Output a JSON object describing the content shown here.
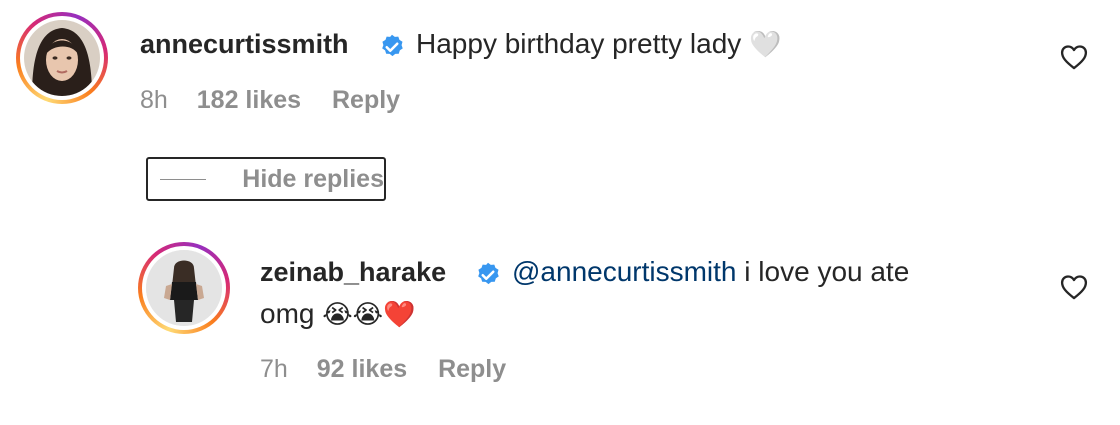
{
  "comment": {
    "username": "annecurtissmith",
    "text": "Happy birthday pretty lady",
    "emoji": "🤍",
    "time": "8h",
    "likes": "182 likes",
    "reply_label": "Reply"
  },
  "toggle": {
    "label": "Hide replies"
  },
  "reply": {
    "username": "zeinab_harake",
    "mention": "@annecurtissmith",
    "text_line1": " i love you ate",
    "text_line2": "omg",
    "emojis": "😭😭❤️",
    "time": "7h",
    "likes": "92 likes",
    "reply_label": "Reply"
  },
  "colors": {
    "verified": "#3897f0",
    "mention": "#00376b",
    "meta": "#8e8e8e",
    "text": "#262626"
  },
  "icons": [
    "verified-badge-icon",
    "heart-outline-icon"
  ]
}
